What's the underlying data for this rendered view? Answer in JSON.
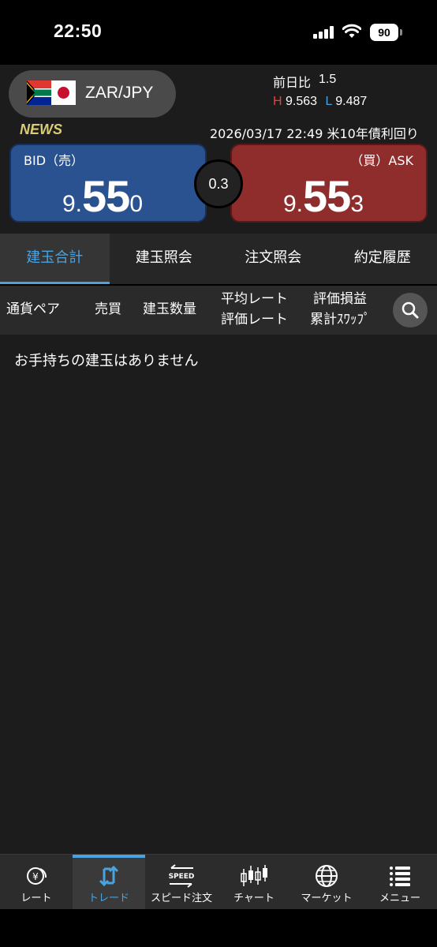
{
  "status_bar": {
    "time": "22:50",
    "battery": "90"
  },
  "header": {
    "pair": "ZAR/JPY",
    "prev_day_label": "前日比",
    "prev_day_value": "1.5",
    "high_label": "H",
    "high_value": "9.563",
    "low_label": "L",
    "low_value": "9.487",
    "news_label": "NEWS",
    "news_text": "2026/03/17 22:49 米10年債利回り"
  },
  "quote": {
    "bid_label": "BID（売）",
    "bid_prefix": "9.",
    "bid_main": "55",
    "bid_suffix": "0",
    "spread": "0.3",
    "ask_label": "（買）ASK",
    "ask_prefix": "9.",
    "ask_main": "55",
    "ask_suffix": "3"
  },
  "tabs": [
    {
      "label": "建玉合計",
      "active": true
    },
    {
      "label": "建玉照会",
      "active": false
    },
    {
      "label": "注文照会",
      "active": false
    },
    {
      "label": "約定履歴",
      "active": false
    }
  ],
  "columns": {
    "pair": "通貨ペア",
    "side": "売買",
    "quantity": "建玉数量",
    "avg_rate": "平均レート",
    "eval_rate": "評価レート",
    "eval_pl": "評価損益",
    "swap": "累計ｽﾜｯﾌﾟ"
  },
  "content": {
    "empty_message": "お手持ちの建玉はありません"
  },
  "bottom_nav": [
    {
      "label": "レート",
      "icon": "rate-icon",
      "active": false
    },
    {
      "label": "トレード",
      "icon": "trade-icon",
      "active": true
    },
    {
      "label": "スピード注文",
      "icon": "speed-order-icon",
      "active": false
    },
    {
      "label": "チャート",
      "icon": "chart-icon",
      "active": false
    },
    {
      "label": "マーケット",
      "icon": "globe-icon",
      "active": false
    },
    {
      "label": "メニュー",
      "icon": "menu-icon",
      "active": false
    }
  ],
  "colors": {
    "accent": "#4aa3e0",
    "bid": "#2a5290",
    "ask": "#8f2c2c",
    "news": "#d9cc74",
    "high": "#e8413c",
    "low": "#4aa3e0"
  }
}
